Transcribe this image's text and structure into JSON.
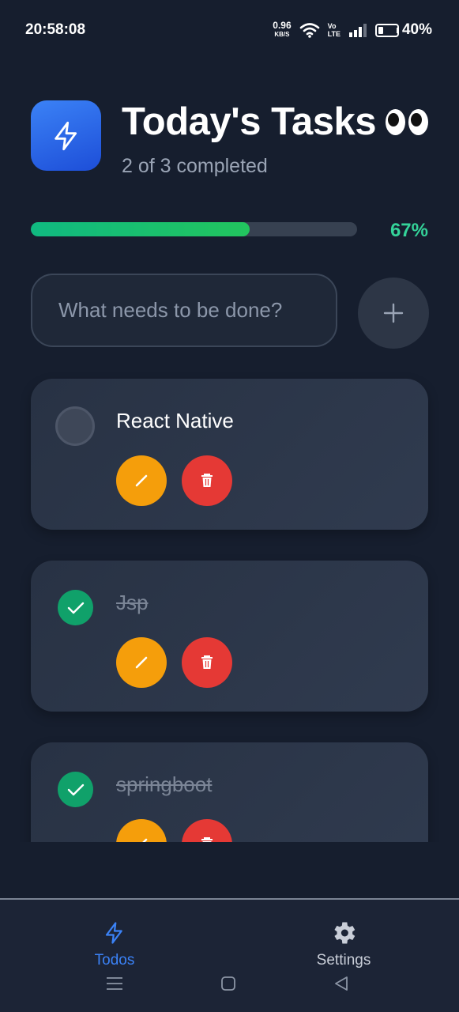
{
  "status_bar": {
    "time": "20:58:08",
    "net_speed": "0.96",
    "net_unit": "KB/S",
    "volte_top": "Vo",
    "volte_bottom": "LTE",
    "battery_pct": "40%",
    "battery_level": 0.4
  },
  "header": {
    "title": "Today's Tasks",
    "emoji": "eyes-emoji",
    "subtitle": "2 of 3 completed"
  },
  "progress": {
    "percent_label": "67%",
    "fraction": 0.67
  },
  "new_task": {
    "placeholder": "What needs to be done?",
    "value": ""
  },
  "tasks": [
    {
      "text": "React Native",
      "completed": false
    },
    {
      "text": "Jsp",
      "completed": true
    },
    {
      "text": "springboot",
      "completed": true
    }
  ],
  "bottom_nav": {
    "tabs": [
      {
        "label": "Todos",
        "icon": "lightning-icon",
        "active": true
      },
      {
        "label": "Settings",
        "icon": "gear-icon",
        "active": false
      }
    ]
  },
  "colors": {
    "background": "#161e2e",
    "accent": "#3b82f6",
    "progress": "#10b981",
    "edit": "#f59e0b",
    "delete": "#e53935",
    "done_check": "#10a16a"
  }
}
